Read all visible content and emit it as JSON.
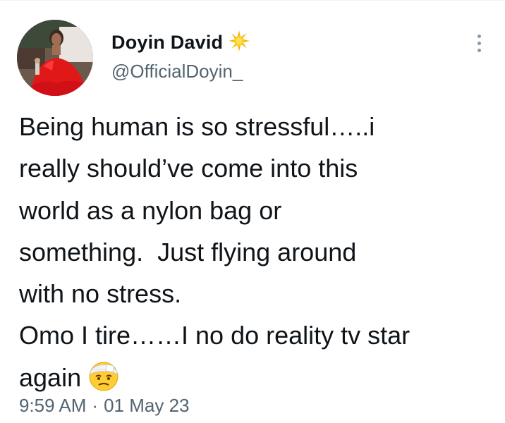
{
  "author": {
    "display_name": "Doyin David",
    "handle": "@OfficialDoyin_",
    "name_emoji_icon": "sun-icon",
    "avatar": "profile-photo"
  },
  "tweet": {
    "lines": [
      "Being human is so stressful…..i",
      "really should’ve come into this",
      "world as a nylon bag or",
      "something.  Just flying around",
      "with no stress.",
      "Omo I tire……I no do reality tv star",
      "again"
    ],
    "trailing_emoji_icon": "face-with-head-bandage-icon"
  },
  "meta": {
    "time": "9:59 AM",
    "separator": "·",
    "date": "01 May 23"
  },
  "more_menu_icon": "more-vertical-icon",
  "colors": {
    "text": "#0f1419",
    "secondary": "#536471",
    "divider": "#eff3f4"
  }
}
